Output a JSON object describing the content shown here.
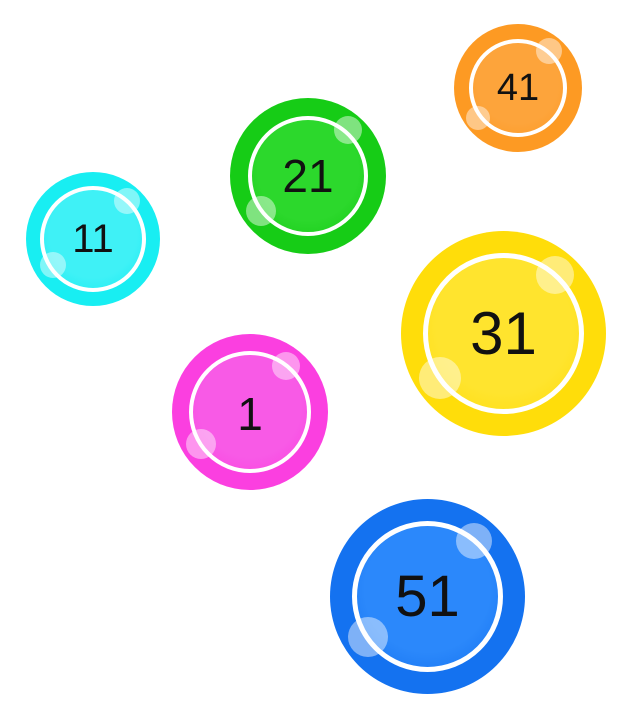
{
  "balls": [
    {
      "id": "b1",
      "number": "1",
      "color": "#fb3fe0",
      "inner_color": "#f85ae6"
    },
    {
      "id": "b11",
      "number": "11",
      "color": "#18eef2",
      "inner_color": "#3ff1f6"
    },
    {
      "id": "b21",
      "number": "21",
      "color": "#16cc16",
      "inner_color": "#2cd82c"
    },
    {
      "id": "b31",
      "number": "31",
      "color": "#ffdd0a",
      "inner_color": "#ffe42e"
    },
    {
      "id": "b41",
      "number": "41",
      "color": "#fd9a23",
      "inner_color": "#fda43b"
    },
    {
      "id": "b51",
      "number": "51",
      "color": "#1472f0",
      "inner_color": "#2b88fb"
    }
  ]
}
